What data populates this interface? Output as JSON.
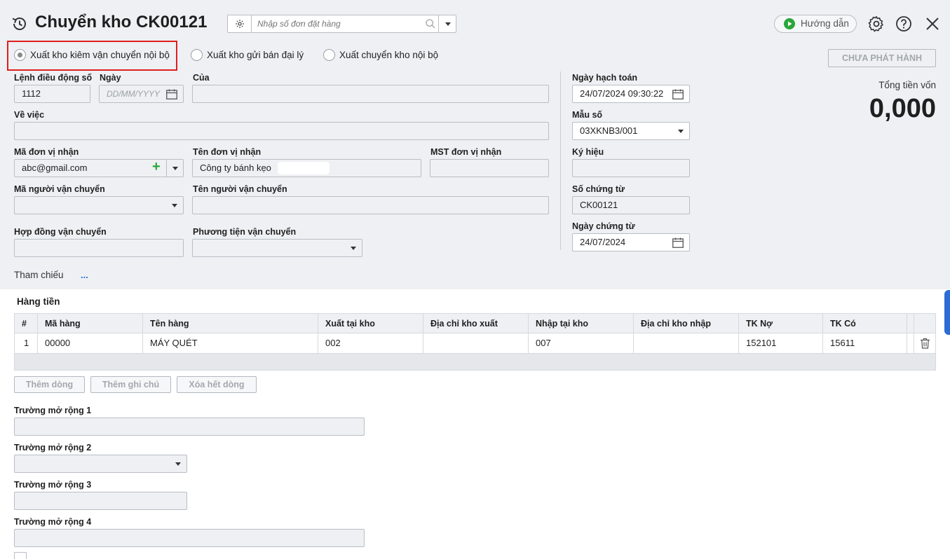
{
  "header": {
    "title": "Chuyển kho CK00121",
    "order_search_placeholder": "Nhập số đơn đặt hàng",
    "guide_label": "Hướng dẫn"
  },
  "options": {
    "opt1": "Xuất kho kiêm vận chuyển nội bộ",
    "opt2": "Xuất kho gửi bán đại lý",
    "opt3": "Xuất chuyển kho nội bộ",
    "selected": 1
  },
  "status_button": "CHƯA PHÁT HÀNH",
  "form": {
    "order_no_label": "Lệnh điều động số",
    "order_no_value": "1112",
    "date_label": "Ngày",
    "date_placeholder": "DD/MM/YYYY",
    "of_label": "Của",
    "about_label": "Về việc",
    "recv_code_label": "Mã đơn vị nhận",
    "recv_code_value": "abc@gmail.com",
    "recv_name_label": "Tên đơn vị nhận",
    "recv_name_value": "Công ty bánh kẹo",
    "recv_tax_label": "MST đơn vị nhận",
    "carrier_code_label": "Mã người vận chuyển",
    "carrier_name_label": "Tên người vận chuyển",
    "contract_label": "Hợp đồng vận chuyển",
    "vehicle_label": "Phương tiện vận chuyển",
    "reference_label": "Tham chiếu",
    "reference_more": "..."
  },
  "right_panel": {
    "posting_date_label": "Ngày hạch toán",
    "posting_date_value": "24/07/2024 09:30:22",
    "template_label": "Mẫu số",
    "template_value": "03XKNB3/001",
    "symbol_label": "Ký hiệu",
    "voucher_no_label": "Số chứng từ",
    "voucher_no_value": "CK00121",
    "voucher_date_label": "Ngày chứng từ",
    "voucher_date_value": "24/07/2024"
  },
  "total": {
    "label": "Tổng tiền vốn",
    "value": "0,000"
  },
  "grid": {
    "section_title": "Hàng tiền",
    "columns": [
      "#",
      "Mã hàng",
      "Tên hàng",
      "Xuất tại kho",
      "Địa chỉ kho xuất",
      "Nhập tại kho",
      "Địa chỉ kho nhập",
      "TK Nợ",
      "TK Có"
    ],
    "rows": [
      [
        "1",
        "00000",
        "MÁY QUÉT",
        "002",
        "",
        "007",
        "",
        "152101",
        "15611"
      ]
    ]
  },
  "grid_buttons": {
    "add_row": "Thêm dòng",
    "add_note": "Thêm ghi chú",
    "delete_all": "Xóa hết dòng"
  },
  "extended": {
    "field1": "Trường mở rộng 1",
    "field2": "Trường mở rộng 2",
    "field3": "Trường mở rộng 3",
    "field4": "Trường mở rộng 4"
  },
  "colors": {
    "highlight_border": "#e01e1e",
    "guide_play": "#2aa63a",
    "add_plus": "#2aa63a",
    "link_blue": "#2b6cd6"
  }
}
